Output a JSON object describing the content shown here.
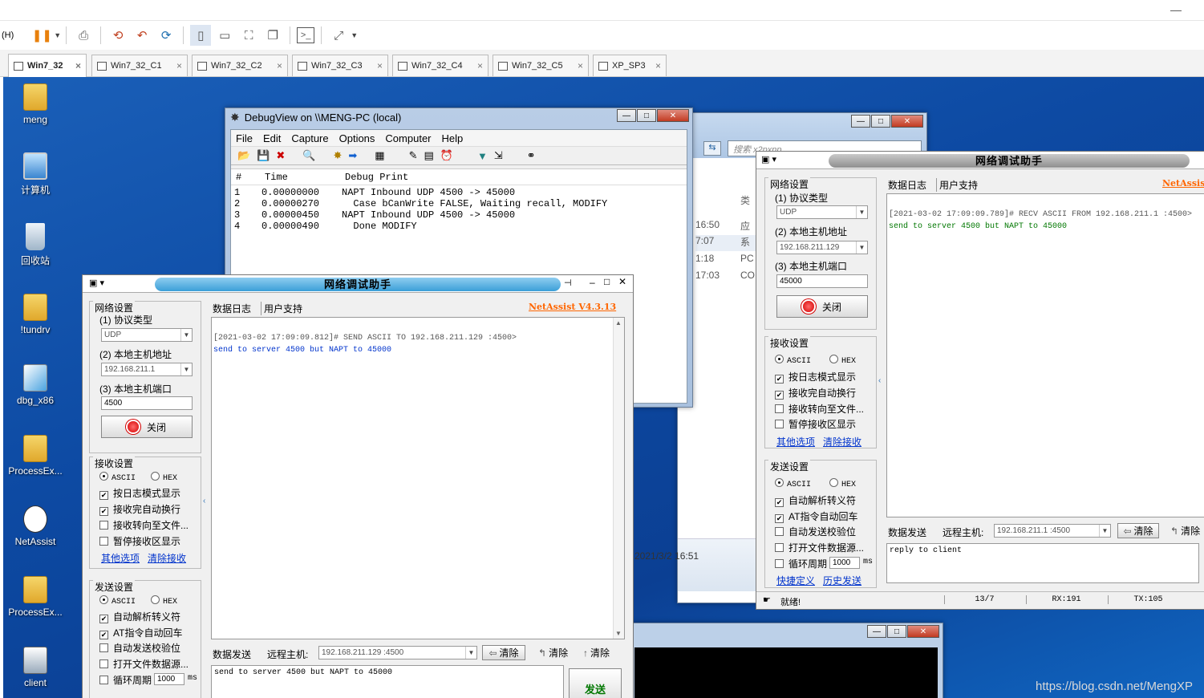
{
  "host": {
    "menu_fragment": "(H)",
    "tabs": [
      {
        "label": "Win7_32",
        "active": true
      },
      {
        "label": "Win7_32_C1"
      },
      {
        "label": "Win7_32_C2"
      },
      {
        "label": "Win7_32_C3"
      },
      {
        "label": "Win7_32_C4"
      },
      {
        "label": "Win7_32_C5"
      },
      {
        "label": "XP_SP3"
      }
    ],
    "close_glyph": "×"
  },
  "desktop": {
    "icons": [
      {
        "label": "meng"
      },
      {
        "label": "计算机"
      },
      {
        "label": "回收站"
      },
      {
        "label": "!tundrv"
      },
      {
        "label": "dbg_x86"
      },
      {
        "label": "ProcessEx..."
      },
      {
        "label": "NetAssist"
      },
      {
        "label": "ProcessEx..."
      },
      {
        "label": "client"
      }
    ],
    "watermark": "https://blog.csdn.net/MengXP"
  },
  "explorer": {
    "search_placeholder": "搜索 x2pxnp",
    "col_type": "类",
    "rows": [
      {
        "time": "16:50",
        "type": "应"
      },
      {
        "time": "7:07",
        "type": "系"
      },
      {
        "time": "1:18",
        "type": "PC"
      },
      {
        "time": "17:03",
        "type": "CO"
      }
    ],
    "footer_date": "2021/3/2 16:51"
  },
  "debugview": {
    "title": "DebugView on \\\\MENG-PC (local)",
    "menu": [
      "File",
      "Edit",
      "Capture",
      "Options",
      "Computer",
      "Help"
    ],
    "columns": [
      "#",
      "Time",
      "Debug Print"
    ],
    "rows": [
      {
        "n": "1",
        "time": "0.00000000",
        "msg": "NAPT Inbound UDP 4500 -> 45000"
      },
      {
        "n": "2",
        "time": "0.00000270",
        "msg": "  Case bCanWrite FALSE, Waiting recall, MODIFY"
      },
      {
        "n": "3",
        "time": "0.00000450",
        "msg": "NAPT Inbound UDP 4500 -> 45000"
      },
      {
        "n": "4",
        "time": "0.00000490",
        "msg": "  Done MODIFY"
      }
    ]
  },
  "netassist_left": {
    "title": "网络调试助手",
    "net_settings": "网络设置",
    "proto_label": "(1) 协议类型",
    "proto_value": "UDP",
    "host_label": "(2) 本地主机地址",
    "host_value": "192.168.211.1",
    "port_label": "(3) 本地主机端口",
    "port_value": "4500",
    "close_btn": "关闭",
    "recv_settings": "接收设置",
    "ascii": "ASCII",
    "hex": "HEX",
    "recv_opts": [
      {
        "label": "按日志模式显示",
        "checked": true
      },
      {
        "label": "接收完自动换行",
        "checked": true
      },
      {
        "label": "接收转向至文件...",
        "checked": false
      },
      {
        "label": "暂停接收区显示",
        "checked": false
      }
    ],
    "more_opts": "其他选项",
    "clear_recv": "清除接收",
    "send_settings": "发送设置",
    "send_opts": [
      {
        "label": "自动解析转义符",
        "checked": true
      },
      {
        "label": "AT指令自动回车",
        "checked": true
      },
      {
        "label": "自动发送校验位",
        "checked": false
      },
      {
        "label": "打开文件数据源...",
        "checked": false
      },
      {
        "label": "循环周期",
        "checked": false
      }
    ],
    "loop_value": "1000",
    "loop_unit": "ms",
    "tab_log": "数据日志",
    "tab_support": "用户支持",
    "brand": "NetAssist V4.3.13",
    "log_header": "[2021-03-02 17:09:09.812]# SEND ASCII TO 192.168.211.129 :4500>",
    "log_body": "send to server 4500 but NAPT to 45000",
    "send_label": "数据发送",
    "remote_label": "远程主机:",
    "remote_value": "192.168.211.129 :4500",
    "clear1": "清除",
    "clear2": "清除",
    "clear3": "清除",
    "send_text": "send to server 4500 but NAPT to 45000",
    "send_btn": "发送"
  },
  "netassist_right": {
    "title": "网络调试助手",
    "net_settings": "网络设置",
    "proto_label": "(1) 协议类型",
    "proto_value": "UDP",
    "host_label": "(2) 本地主机地址",
    "host_value": "192.168.211.129",
    "port_label": "(3) 本地主机端口",
    "port_value": "45000",
    "close_btn": "关闭",
    "recv_settings": "接收设置",
    "ascii": "ASCII",
    "hex": "HEX",
    "recv_opts": [
      {
        "label": "按日志模式显示",
        "checked": true
      },
      {
        "label": "接收完自动换行",
        "checked": true
      },
      {
        "label": "接收转向至文件...",
        "checked": false
      },
      {
        "label": "暂停接收区显示",
        "checked": false
      }
    ],
    "more_opts": "其他选项",
    "clear_recv": "清除接收",
    "send_settings": "发送设置",
    "send_opts": [
      {
        "label": "自动解析转义符",
        "checked": true
      },
      {
        "label": "AT指令自动回车",
        "checked": true
      },
      {
        "label": "自动发送校验位",
        "checked": false
      },
      {
        "label": "打开文件数据源...",
        "checked": false
      },
      {
        "label": "循环周期",
        "checked": false
      }
    ],
    "loop_value": "1000",
    "loop_unit": "ms",
    "quick_def": "快捷定义",
    "history": "历史发送",
    "tab_log": "数据日志",
    "tab_support": "用户支持",
    "brand": "NetAssis",
    "log_header": "[2021-03-02 17:09:09.789]# RECV ASCII FROM 192.168.211.1 :4500>",
    "log_body": "send to server 4500 but NAPT to 45000",
    "send_label": "数据发送",
    "remote_label": "远程主机:",
    "remote_value": "192.168.211.1 :4500",
    "clear1": "清除",
    "clear2": "清除",
    "send_text": "reply to client",
    "status_ready": "就绪!",
    "status_count": "13/7",
    "status_rx": "RX:191",
    "status_tx": "TX:105"
  }
}
